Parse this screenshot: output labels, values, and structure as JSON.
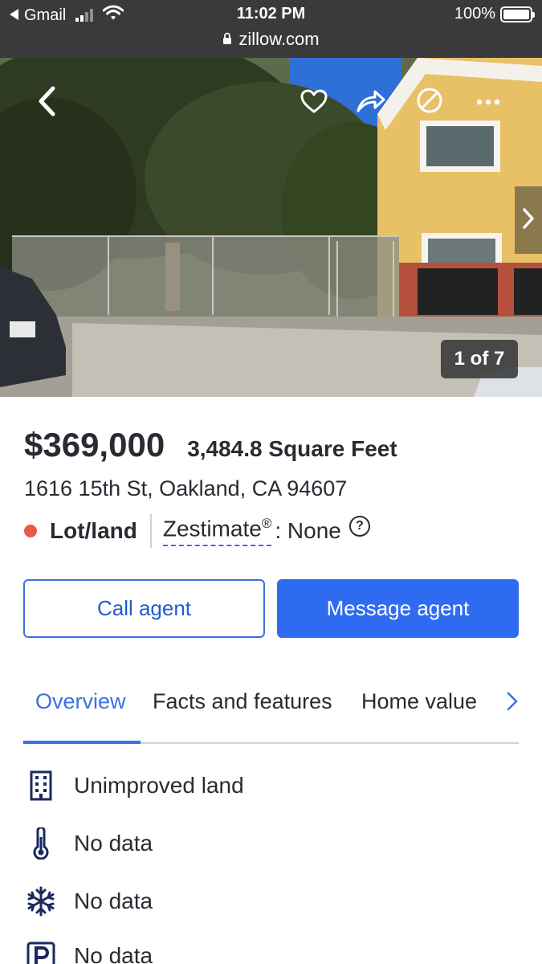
{
  "status_bar": {
    "back_app": "Gmail",
    "time": "11:02 PM",
    "battery": "100%",
    "url": "zillow.com"
  },
  "photo": {
    "counter": "1 of 7",
    "icons": [
      "back-icon",
      "heart-icon",
      "share-icon",
      "hide-icon",
      "more-icon",
      "next-photo-icon"
    ]
  },
  "listing": {
    "price": "$369,000",
    "sqft": "3,484.8 Square Feet",
    "address": "1616 15th St, Oakland, CA 94607",
    "type": "Lot/land",
    "zestimate_label": "Zestimate",
    "zestimate_reg": "®",
    "zestimate_value": ": None",
    "help": "?",
    "status_color": "#eb5a46"
  },
  "actions": {
    "call": "Call agent",
    "message": "Message agent"
  },
  "tabs": [
    "Overview",
    "Facts and features",
    "Home value"
  ],
  "facts": [
    {
      "icon": "building-icon",
      "label": "Unimproved land"
    },
    {
      "icon": "thermometer-icon",
      "label": "No data"
    },
    {
      "icon": "snowflake-icon",
      "label": "No data"
    },
    {
      "icon": "parking-icon",
      "label": "No data"
    }
  ],
  "colors": {
    "accent": "#3d6fe0",
    "primary_button": "#2e6bf0",
    "text": "#2a2a33"
  }
}
